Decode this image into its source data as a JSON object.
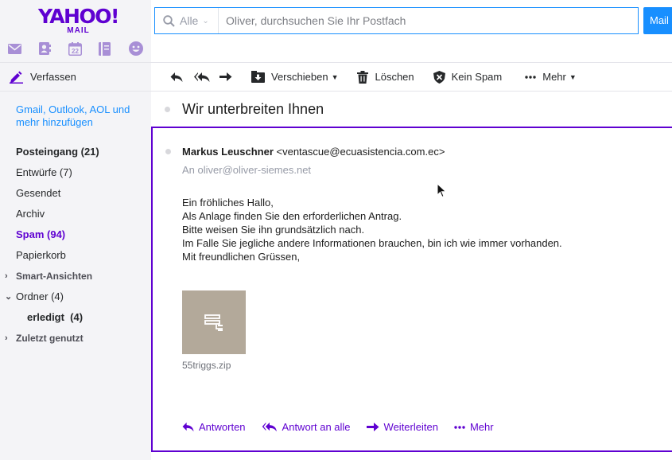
{
  "brand": {
    "name": "YAHOO!",
    "sub": "MAIL",
    "accent": "#5f01d1",
    "link": "#188fff"
  },
  "apps": [
    {
      "icon": "mail-icon"
    },
    {
      "icon": "contacts-icon"
    },
    {
      "icon": "calendar-icon",
      "label": "22"
    },
    {
      "icon": "notepad-icon"
    },
    {
      "icon": "messenger-icon"
    }
  ],
  "compose": {
    "label": "Verfassen"
  },
  "search": {
    "scope": "Alle",
    "placeholder": "Oliver, durchsuchen Sie Ihr Postfach",
    "value": "",
    "button": "Mail"
  },
  "sidebar": {
    "add_accounts": "Gmail, Outlook, AOL und mehr hinzufügen",
    "items": [
      {
        "label": "Posteingang (21)"
      },
      {
        "label": "Entwürfe (7)"
      },
      {
        "label": "Gesendet"
      },
      {
        "label": "Archiv"
      },
      {
        "label": "Spam (94)"
      },
      {
        "label": "Papierkorb"
      }
    ],
    "smart_views": "Smart-Ansichten",
    "folders": "Ordner (4)",
    "subfolder": "erledigt  (4)",
    "recent": "Zuletzt genutzt"
  },
  "toolbar": {
    "move": "Verschieben",
    "delete": "Löschen",
    "not_spam": "Kein Spam",
    "more": "Mehr"
  },
  "message": {
    "subject": "Wir unterbreiten Ihnen",
    "sender_name": "Markus Leuschner",
    "sender_email": "<ventascue@ecuasistencia.com.ec>",
    "to_prefix": "An",
    "to": "oliver@oliver-siemes.net",
    "body": [
      "Ein fröhliches Hallo,",
      "Als Anlage finden Sie den erforderlichen Antrag.",
      "Bitte weisen Sie ihn grundsätzlich nach.",
      "Im Falle Sie jegliche andere Informationen brauchen, bin ich wie immer vorhanden.",
      "Mit freundlichen Grüssen,"
    ],
    "attachment": "55triggs.zip",
    "actions": {
      "reply": "Antworten",
      "reply_all": "Antwort an alle",
      "forward": "Weiterleiten",
      "more": "Mehr"
    }
  }
}
